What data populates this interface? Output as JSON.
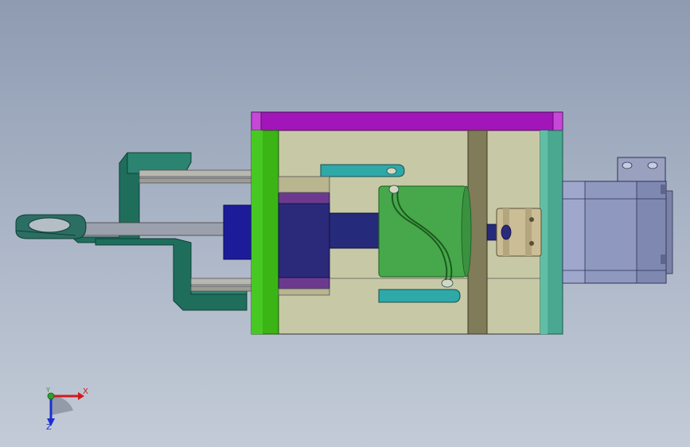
{
  "triad": {
    "x_label": "X",
    "y_label": "Y",
    "z_label": "Z",
    "x_color": "#d21a1a",
    "y_color": "#2e9e2e",
    "z_color": "#1c2fd0"
  },
  "parts": [
    {
      "name": "top-plate",
      "color": "#a215b8"
    },
    {
      "name": "left-end-plate",
      "color": "#3bb515"
    },
    {
      "name": "right-end-plate",
      "color": "#4aa890"
    },
    {
      "name": "housing-body",
      "color": "#c7c9a6"
    },
    {
      "name": "swing-arm-linkage",
      "color": "#1f6e5c"
    },
    {
      "name": "rod-eye-end",
      "color": "#2c6e63"
    },
    {
      "name": "piston-head",
      "color": "#2b2a7a"
    },
    {
      "name": "drive-shaft",
      "color": "#262a7a"
    },
    {
      "name": "cam-cylinder",
      "color": "#46a84a"
    },
    {
      "name": "shaft-coupling",
      "color": "#cbbd95"
    },
    {
      "name": "servo-motor",
      "color": "#8f98bf"
    },
    {
      "name": "support-bar",
      "color": "#807b58"
    },
    {
      "name": "guide-links",
      "color": "#2fa8a8"
    }
  ]
}
